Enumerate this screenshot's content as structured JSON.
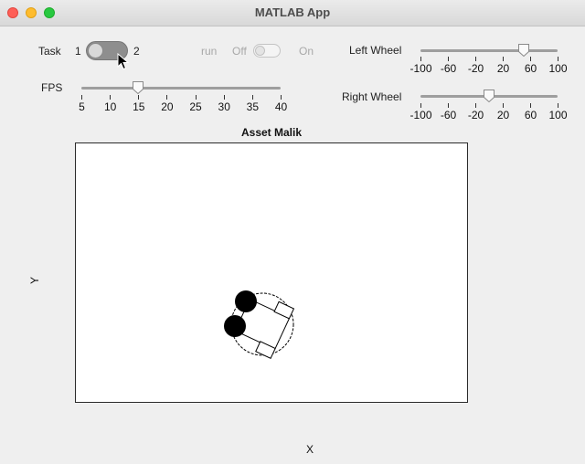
{
  "window": {
    "title": "MATLAB App"
  },
  "task": {
    "label": "Task",
    "left_value": "1",
    "right_value": "2",
    "selected": "1"
  },
  "run": {
    "label": "run",
    "off_label": "Off",
    "on_label": "On",
    "state": "Off"
  },
  "fps": {
    "label": "FPS",
    "ticks": [
      "5",
      "10",
      "15",
      "20",
      "25",
      "30",
      "35",
      "40"
    ],
    "min": 5,
    "max": 40,
    "value": 15
  },
  "left_wheel": {
    "label": "Left Wheel",
    "ticks": [
      "-100",
      "-60",
      "-20",
      "20",
      "60",
      "100"
    ],
    "min": -100,
    "max": 100,
    "value": 50
  },
  "right_wheel": {
    "label": "Right Wheel",
    "ticks": [
      "-100",
      "-60",
      "-20",
      "20",
      "60",
      "100"
    ],
    "min": -100,
    "max": 100,
    "value": 0
  },
  "axes": {
    "title": "Asset Malik",
    "xlabel": "X",
    "ylabel": "Y"
  },
  "colors": {
    "track": "#9e9e9e",
    "switch_on": "#8e8e8e",
    "robot": "#000000"
  }
}
